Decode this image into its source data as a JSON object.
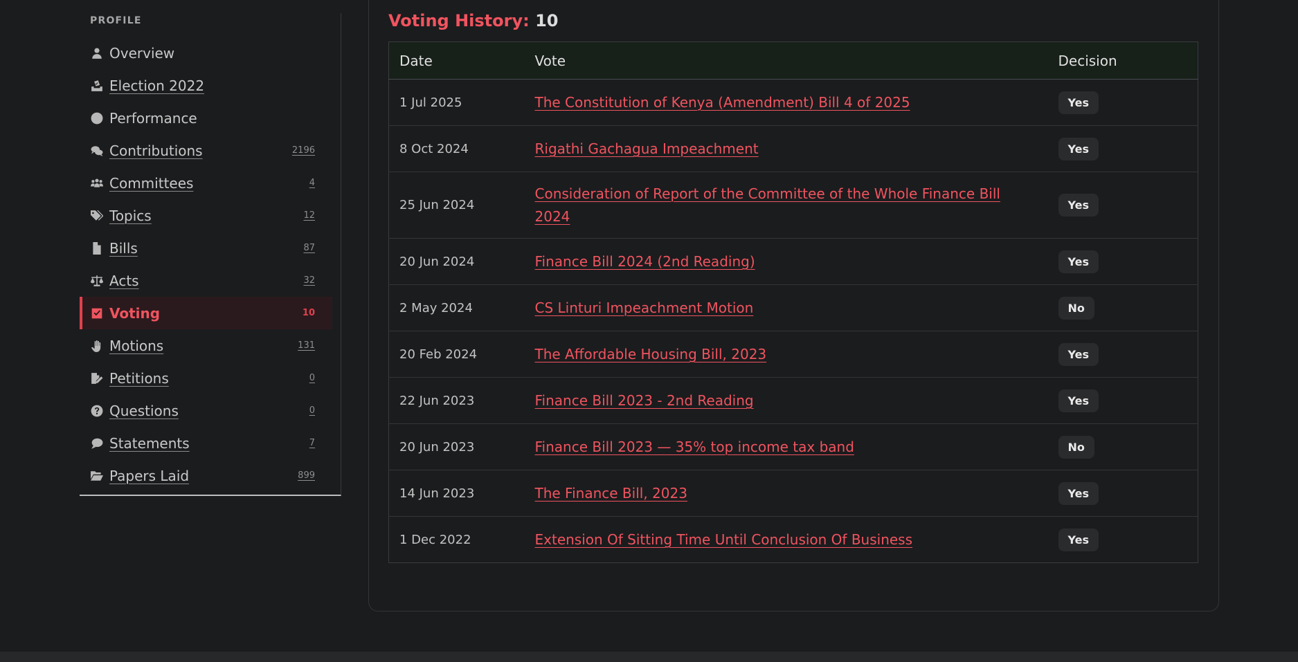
{
  "sidebar": {
    "heading": "PROFILE",
    "items": [
      {
        "label": "Overview",
        "count": "",
        "icon": "person-icon"
      },
      {
        "label": "Election 2022",
        "count": "",
        "icon": "ballot-box-icon"
      },
      {
        "label": "Performance",
        "count": "",
        "icon": "circle-icon"
      },
      {
        "label": "Contributions",
        "count": "2196",
        "icon": "comments-icon"
      },
      {
        "label": "Committees",
        "count": "4",
        "icon": "users-icon"
      },
      {
        "label": "Topics",
        "count": "12",
        "icon": "tags-icon"
      },
      {
        "label": "Bills",
        "count": "87",
        "icon": "file-icon"
      },
      {
        "label": "Acts",
        "count": "32",
        "icon": "scale-icon"
      },
      {
        "label": "Voting",
        "count": "10",
        "icon": "check-square-icon",
        "active": true
      },
      {
        "label": "Motions",
        "count": "131",
        "icon": "hand-icon"
      },
      {
        "label": "Petitions",
        "count": "0",
        "icon": "file-signature-icon"
      },
      {
        "label": "Questions",
        "count": "0",
        "icon": "question-circle-icon"
      },
      {
        "label": "Statements",
        "count": "7",
        "icon": "speech-bubble-icon"
      },
      {
        "label": "Papers Laid",
        "count": "899",
        "icon": "folder-open-icon"
      }
    ]
  },
  "voting": {
    "title_label": "Voting History:",
    "title_count": "10",
    "columns": {
      "date": "Date",
      "vote": "Vote",
      "decision": "Decision"
    },
    "rows": [
      {
        "date": "1 Jul 2025",
        "vote": "The Constitution of Kenya (Amendment) Bill 4 of 2025",
        "decision": "Yes"
      },
      {
        "date": "8 Oct 2024",
        "vote": "Rigathi Gachagua Impeachment",
        "decision": "Yes"
      },
      {
        "date": "25 Jun 2024",
        "vote": "Consideration of Report of the Committee of the Whole Finance Bill 2024",
        "decision": "Yes"
      },
      {
        "date": "20 Jun 2024",
        "vote": "Finance Bill 2024 (2nd Reading)",
        "decision": "Yes"
      },
      {
        "date": "2 May 2024",
        "vote": "CS Linturi Impeachment Motion",
        "decision": "No"
      },
      {
        "date": "20 Feb 2024",
        "vote": "The Affordable Housing Bill, 2023",
        "decision": "Yes"
      },
      {
        "date": "22 Jun 2023",
        "vote": "Finance Bill 2023 - 2nd Reading",
        "decision": "Yes"
      },
      {
        "date": "20 Jun 2023",
        "vote": "Finance Bill 2023 — 35% top income tax band",
        "decision": "No"
      },
      {
        "date": "14 Jun 2023",
        "vote": "The Finance Bill, 2023",
        "decision": "Yes"
      },
      {
        "date": "1 Dec 2022",
        "vote": "Extension Of Sitting Time Until Conclusion Of Business",
        "decision": "Yes"
      }
    ]
  },
  "colors": {
    "background": "#1b1c1e",
    "accent": "#f0545f",
    "active_bg": "#2b1a1d",
    "table_header_bg": "#172019",
    "badge_bg": "#2a2b2d"
  }
}
